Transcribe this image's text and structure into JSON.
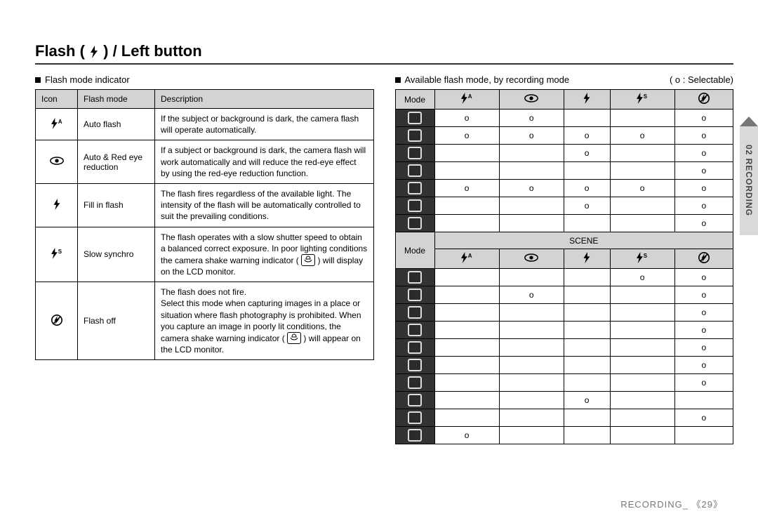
{
  "title_parts": {
    "a": "Flash ( ",
    "b": " ) / Left button"
  },
  "left": {
    "subtitle": "Flash mode indicator",
    "headers": {
      "icon": "Icon",
      "mode": "Flash mode",
      "desc": "Description"
    },
    "rows": [
      {
        "icon": "flash-auto",
        "mode": "Auto flash",
        "desc": "If the subject or background is dark, the camera flash will operate automatically."
      },
      {
        "icon": "redeye",
        "mode": "Auto & Red eye reduction",
        "desc": "If a subject or background is dark, the camera flash will work automatically and will reduce the red-eye effect by using the red-eye reduction function."
      },
      {
        "icon": "flash",
        "mode": "Fill in flash",
        "desc": "The flash fires regardless of the available light. The intensity of the flash will be automatically controlled to suit the prevailing conditions."
      },
      {
        "icon": "flash-slow",
        "mode": "Slow synchro",
        "desc_a": "The flash operates with a slow shutter speed to obtain a balanced correct exposure. In poor lighting conditions the camera shake warning indicator ( ",
        "desc_b": " ) will display on the LCD monitor."
      },
      {
        "icon": "flash-off",
        "mode": "Flash off",
        "desc_a": "The flash does not fire.\nSelect this mode when capturing images in a place or situation where flash photography is prohibited. When you capture an image in poorly lit conditions, the camera shake warning indicator ( ",
        "desc_b": " ) will appear on the LCD monitor."
      }
    ]
  },
  "right": {
    "subtitle": "Available flash mode, by recording mode",
    "note": "( o : Selectable)",
    "mode_label": "Mode",
    "scene_label": "SCENE",
    "col_icons": [
      "flash-auto",
      "redeye",
      "flash",
      "flash-slow",
      "flash-off"
    ],
    "rows_top": [
      [
        "o",
        "o",
        "",
        "",
        "o"
      ],
      [
        "o",
        "o",
        "o",
        "o",
        "o"
      ],
      [
        "",
        "",
        "o",
        "",
        "o"
      ],
      [
        "",
        "",
        "",
        "",
        "o"
      ],
      [
        "o",
        "o",
        "o",
        "o",
        "o"
      ],
      [
        "",
        "",
        "o",
        "",
        "o"
      ],
      [
        "",
        "",
        "",
        "",
        "o"
      ]
    ],
    "rows_scene": [
      [
        "",
        "",
        "",
        "o",
        "o"
      ],
      [
        "",
        "o",
        "",
        "",
        "o"
      ],
      [
        "",
        "",
        "",
        "",
        "o"
      ],
      [
        "",
        "",
        "",
        "",
        "o"
      ],
      [
        "",
        "",
        "",
        "",
        "o"
      ],
      [
        "",
        "",
        "",
        "",
        "o"
      ],
      [
        "",
        "",
        "",
        "",
        "o"
      ],
      [
        "",
        "",
        "o",
        "",
        ""
      ],
      [
        "",
        "",
        "",
        "",
        "o"
      ],
      [
        "o",
        "",
        "",
        "",
        ""
      ]
    ]
  },
  "sidetab": "02 RECORDING",
  "footer": "RECORDING_ 《29》",
  "chart_data": {
    "type": "table",
    "title": "Available flash mode, by recording mode (o = Selectable)",
    "columns": [
      "Flash Auto (⚡A)",
      "Red-eye (👁)",
      "Fill-in (⚡)",
      "Slow synchro (⚡S)",
      "Flash off (⊘⚡)"
    ],
    "row_groups": [
      {
        "name": "Recording modes (top)",
        "rows": [
          [
            "o",
            "o",
            "",
            "",
            "o"
          ],
          [
            "o",
            "o",
            "o",
            "o",
            "o"
          ],
          [
            "",
            "",
            "o",
            "",
            "o"
          ],
          [
            "",
            "",
            "",
            "",
            "o"
          ],
          [
            "o",
            "o",
            "o",
            "o",
            "o"
          ],
          [
            "",
            "",
            "o",
            "",
            "o"
          ],
          [
            "",
            "",
            "",
            "",
            "o"
          ]
        ]
      },
      {
        "name": "SCENE modes",
        "rows": [
          [
            "",
            "",
            "",
            "o",
            "o"
          ],
          [
            "",
            "o",
            "",
            "",
            "o"
          ],
          [
            "",
            "",
            "",
            "",
            "o"
          ],
          [
            "",
            "",
            "",
            "",
            "o"
          ],
          [
            "",
            "",
            "",
            "",
            "o"
          ],
          [
            "",
            "",
            "",
            "",
            "o"
          ],
          [
            "",
            "",
            "",
            "",
            "o"
          ],
          [
            "",
            "",
            "o",
            "",
            ""
          ],
          [
            "",
            "",
            "",
            "",
            "o"
          ],
          [
            "o",
            "",
            "",
            "",
            ""
          ]
        ]
      }
    ]
  }
}
